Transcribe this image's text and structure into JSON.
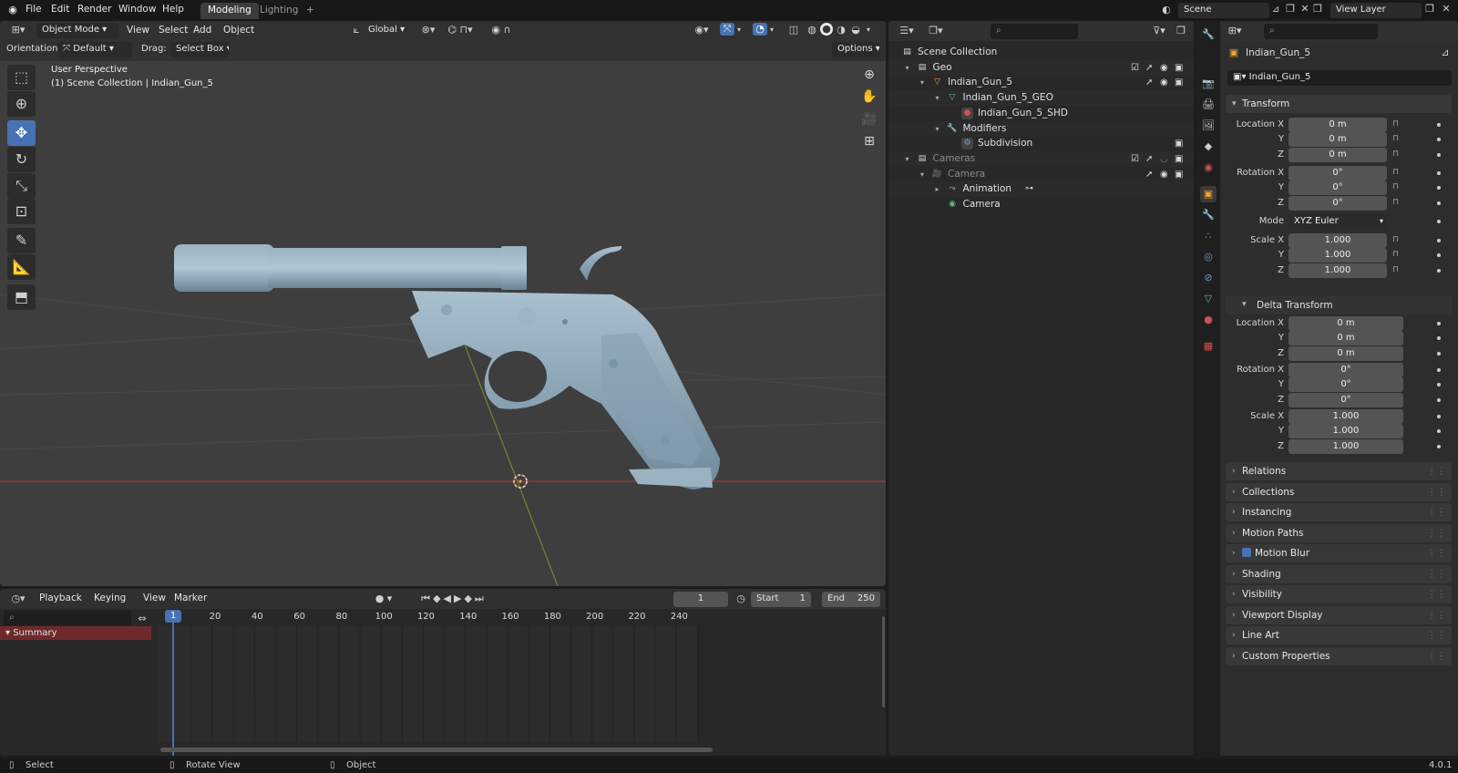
{
  "topbar": {
    "menus": [
      "File",
      "Edit",
      "Render",
      "Window",
      "Help"
    ],
    "workspaces": [
      {
        "label": "Modeling",
        "active": true
      },
      {
        "label": "Lighting",
        "active": false
      }
    ],
    "add_workspace": "+",
    "scene_name": "Scene",
    "view_layer": "View Layer"
  },
  "viewport": {
    "mode": "Object Mode",
    "menus": [
      "View",
      "Select",
      "Add",
      "Object"
    ],
    "transform_space": "Global",
    "orientation_label": "Orientation:",
    "orientation_value": "Default",
    "drag_label": "Drag:",
    "drag_value": "Select Box",
    "options": "Options",
    "overlay_title": "User Perspective",
    "overlay_subtitle": "(1) Scene Collection | Indian_Gun_5",
    "tools": [
      "select-box-icon",
      "cursor-icon",
      "move-icon",
      "rotate-icon",
      "scale-icon",
      "transform-icon",
      "annotate-icon",
      "measure-icon",
      "add-cube-icon"
    ],
    "nav": [
      "zoom-icon",
      "pan-hand-icon",
      "camera-view-icon",
      "grid-ortho-icon"
    ]
  },
  "outliner": {
    "rows": [
      {
        "label": "Scene Collection",
        "indent": 0,
        "icon": "collection-icon",
        "color": "#e0e0e0",
        "arrow": ""
      },
      {
        "label": "Geo",
        "indent": 1,
        "icon": "collection-icon",
        "color": "#e0e0e0",
        "arrow": "▾",
        "check": true,
        "select": true,
        "eye": true,
        "cam": true
      },
      {
        "label": "Indian_Gun_5",
        "indent": 2,
        "icon": "object-icon",
        "color": "#e0e0e0",
        "arrow": "▾",
        "select": true,
        "eye": true,
        "cam": true
      },
      {
        "label": "Indian_Gun_5_GEO",
        "indent": 3,
        "icon": "mesh-icon",
        "color": "#e0e0e0",
        "arrow": "▾"
      },
      {
        "label": "Indian_Gun_5_SHD",
        "indent": 4,
        "icon": "material-icon",
        "color": "#e0e0e0",
        "arrow": ""
      },
      {
        "label": "Modifiers",
        "indent": 3,
        "icon": "wrench-icon",
        "color": "#e0e0e0",
        "arrow": "▾"
      },
      {
        "label": "Subdivision",
        "indent": 4,
        "icon": "modifier-icon",
        "color": "#e0e0e0",
        "arrow": "",
        "cam": true
      },
      {
        "label": "Cameras",
        "indent": 1,
        "icon": "collection-icon",
        "color": "#8a8a8a",
        "arrow": "▾",
        "check": true,
        "select": true,
        "eyeoff": true,
        "cam": true
      },
      {
        "label": "Camera",
        "indent": 2,
        "icon": "camera-object-icon",
        "color": "#8a8a8a",
        "arrow": "▾",
        "select": true,
        "eye": true,
        "cam": true
      },
      {
        "label": "Animation",
        "indent": 3,
        "icon": "animation-icon",
        "color": "#e0e0e0",
        "arrow": "▸"
      },
      {
        "label": "Camera",
        "indent": 3,
        "icon": "camera-data-icon",
        "color": "#e0e0e0",
        "arrow": ""
      }
    ]
  },
  "properties": {
    "object_name": "Indian_Gun_5",
    "data_name": "Indian_Gun_5",
    "transform": {
      "title": "Transform",
      "location": [
        {
          "axis": "Location X",
          "value": "0 m"
        },
        {
          "axis": "Y",
          "value": "0 m"
        },
        {
          "axis": "Z",
          "value": "0 m"
        }
      ],
      "rotation": [
        {
          "axis": "Rotation X",
          "value": "0°"
        },
        {
          "axis": "Y",
          "value": "0°"
        },
        {
          "axis": "Z",
          "value": "0°"
        }
      ],
      "mode_label": "Mode",
      "mode_value": "XYZ Euler",
      "scale": [
        {
          "axis": "Scale X",
          "value": "1.000"
        },
        {
          "axis": "Y",
          "value": "1.000"
        },
        {
          "axis": "Z",
          "value": "1.000"
        }
      ]
    },
    "delta": {
      "title": "Delta Transform",
      "location": [
        {
          "axis": "Location X",
          "value": "0 m"
        },
        {
          "axis": "Y",
          "value": "0 m"
        },
        {
          "axis": "Z",
          "value": "0 m"
        }
      ],
      "rotation": [
        {
          "axis": "Rotation X",
          "value": "0°"
        },
        {
          "axis": "Y",
          "value": "0°"
        },
        {
          "axis": "Z",
          "value": "0°"
        }
      ],
      "scale": [
        {
          "axis": "Scale X",
          "value": "1.000"
        },
        {
          "axis": "Y",
          "value": "1.000"
        },
        {
          "axis": "Z",
          "value": "1.000"
        }
      ]
    },
    "sections": [
      "Relations",
      "Collections",
      "Instancing",
      "Motion Paths",
      "Motion Blur",
      "Shading",
      "Visibility",
      "Viewport Display",
      "Line Art",
      "Custom Properties"
    ]
  },
  "timeline": {
    "menus": [
      "Playback",
      "Keying",
      "View",
      "Marker"
    ],
    "current_frame": "1",
    "start_label": "Start",
    "start_value": "1",
    "end_label": "End",
    "end_value": "250",
    "ruler": [
      "20",
      "40",
      "60",
      "80",
      "100",
      "120",
      "140",
      "160",
      "180",
      "200",
      "220",
      "240"
    ],
    "summary": "Summary"
  },
  "status": {
    "select": "Select",
    "rotate": "Rotate View",
    "object": "Object",
    "version": "4.0.1"
  }
}
